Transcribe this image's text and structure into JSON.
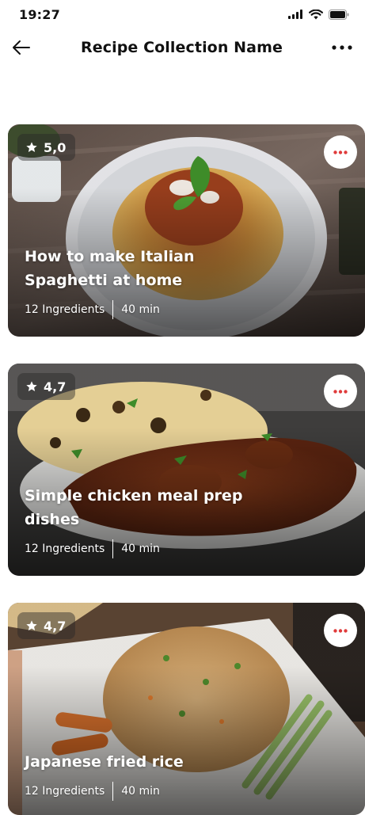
{
  "status_bar": {
    "time": "19:27"
  },
  "header": {
    "title": "Recipe Collection Name"
  },
  "colors": {
    "accent": "#e03b3b",
    "text": "#121212"
  },
  "recipes": [
    {
      "rating": "5,0",
      "title": "How to make Italian Spaghetti at home",
      "ingredients": "12 Ingredients",
      "time": "40 min"
    },
    {
      "rating": "4,7",
      "title": "Simple chicken meal prep dishes",
      "ingredients": "12 Ingredients",
      "time": "40 min"
    },
    {
      "rating": "4,7",
      "title": "Japanese fried rice",
      "ingredients": "12 Ingredients",
      "time": "40 min"
    }
  ],
  "icons": {
    "back": "arrow-left-icon",
    "menu": "more-horizontal-icon",
    "rating": "star-icon",
    "signal": "signal-icon",
    "wifi": "wifi-icon",
    "battery": "battery-icon"
  }
}
